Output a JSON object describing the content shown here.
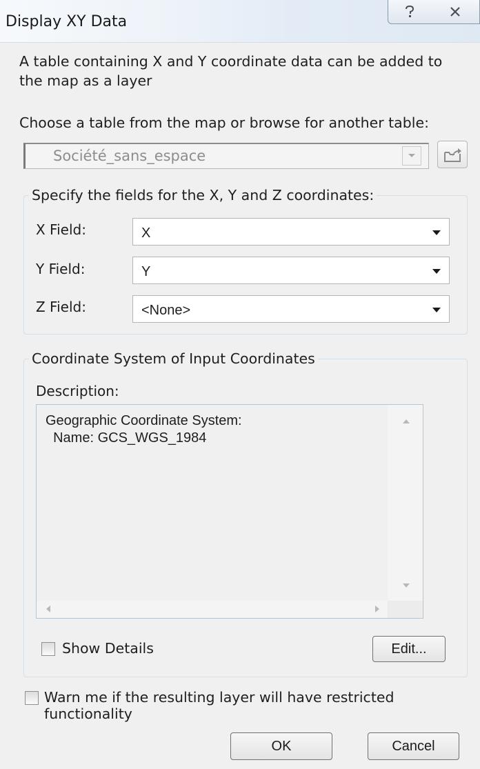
{
  "window": {
    "title": "Display XY Data",
    "help_icon": "help-icon",
    "close_icon": "close-icon"
  },
  "intro_text": "A table containing X and Y coordinate data can be added to the map as a layer",
  "choose_label": "Choose a table from the map or browse for another table:",
  "table_select": {
    "value": "Société_sans_espace",
    "disabled": true
  },
  "fields_group": {
    "legend": "Specify the fields for the X, Y and Z coordinates:",
    "x": {
      "label": "X Field:",
      "value": "X"
    },
    "y": {
      "label": "Y Field:",
      "value": "Y"
    },
    "z": {
      "label": "Z Field:",
      "value": "<None>"
    }
  },
  "coord_group": {
    "legend": "Coordinate System of Input Coordinates",
    "description_label": "Description:",
    "description_lines": [
      "Geographic Coordinate System:",
      "  Name: GCS_WGS_1984"
    ],
    "show_details_label": "Show Details",
    "show_details_checked": false,
    "edit_button": "Edit..."
  },
  "warn_label": "Warn me if the resulting layer will have restricted functionality",
  "warn_checked": false,
  "buttons": {
    "ok": "OK",
    "cancel": "Cancel"
  },
  "colors": {
    "background": "#f0f0f0",
    "group_border": "#d5dfe5",
    "disabled_text": "#8d8d8d"
  }
}
